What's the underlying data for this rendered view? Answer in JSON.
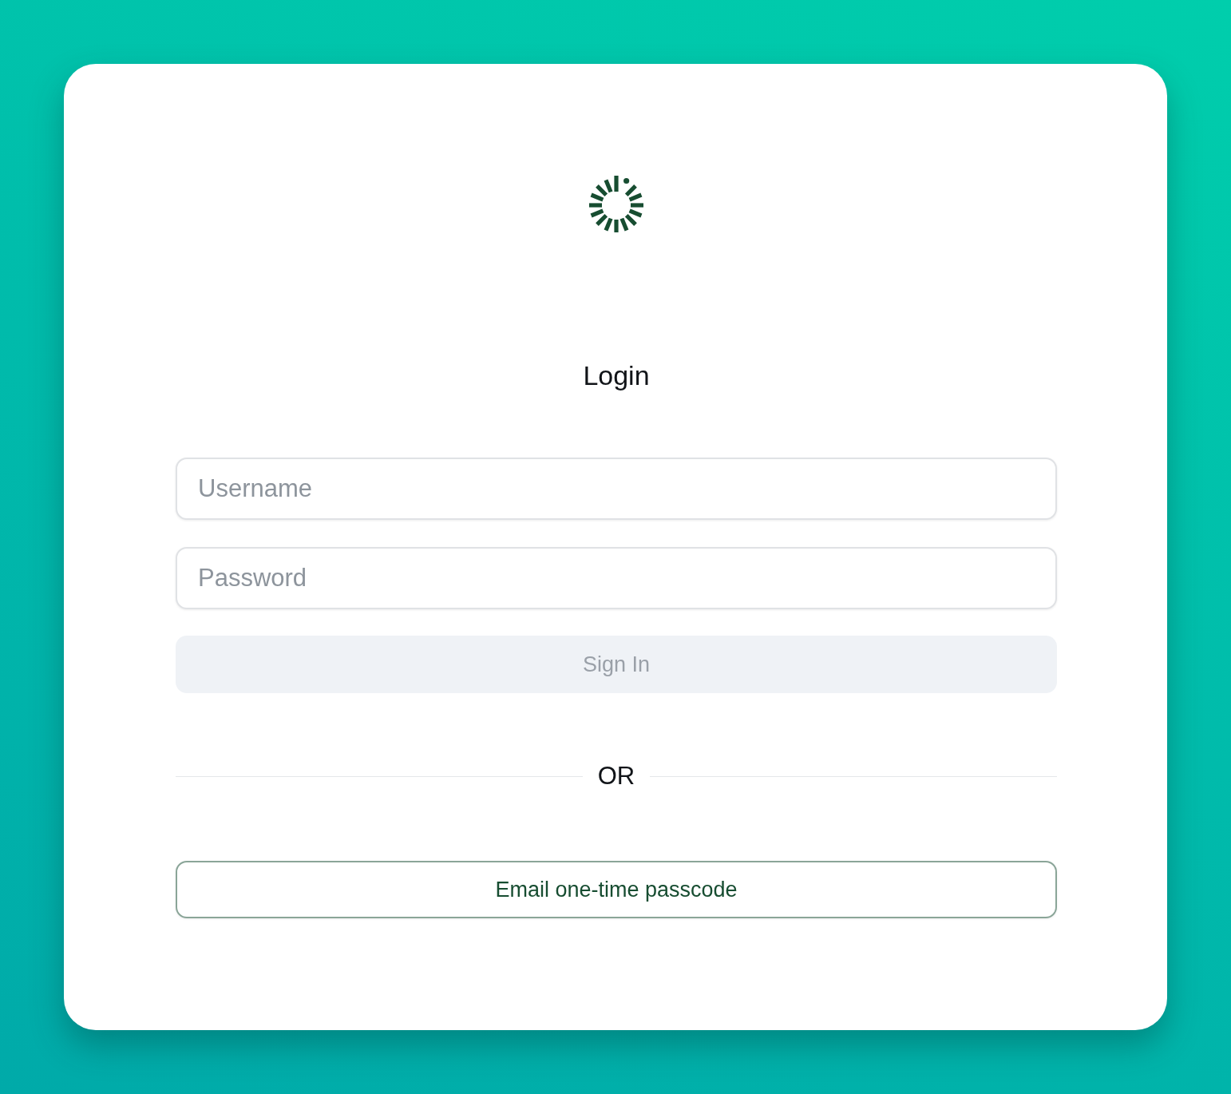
{
  "title": "Login",
  "fields": [
    {
      "placeholder": "Username"
    },
    {
      "placeholder": "Password"
    }
  ],
  "sign_in_button": {
    "label": "Sign In",
    "disabled": true
  },
  "divider": {
    "label": "OR"
  },
  "otp_button": {
    "label": "Email one-time passcode"
  }
}
